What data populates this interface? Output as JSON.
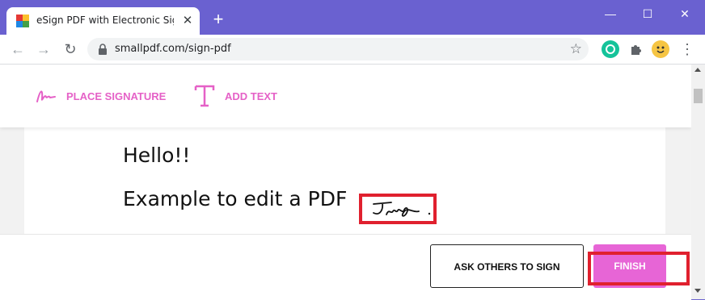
{
  "browser": {
    "tab_title": "eSign PDF with Electronic Signatu",
    "tab_close": "✕",
    "new_tab": "+",
    "window_controls": {
      "minimize": "—",
      "maximize": "☐",
      "close": "✕"
    },
    "nav": {
      "back": "←",
      "forward": "→",
      "reload": "↻"
    },
    "url": "smallpdf.com/sign-pdf",
    "bookmark_icon": "star-icon",
    "extensions": [
      "grammarly-icon",
      "puzzle-icon",
      "profile-avatar"
    ],
    "menu": "⋮"
  },
  "app": {
    "tools": [
      {
        "label": "PLACE SIGNATURE",
        "icon": "signature-icon"
      },
      {
        "label": "ADD TEXT",
        "icon": "text-T-icon"
      }
    ],
    "accent_color": "#e561c7"
  },
  "document": {
    "line1": "Hello!!",
    "line2": "Example to edit a PDF"
  },
  "footer": {
    "ask_button": "ASK OTHERS TO SIGN",
    "finish_button": "FINISH"
  },
  "highlight_color": "#e0202e"
}
